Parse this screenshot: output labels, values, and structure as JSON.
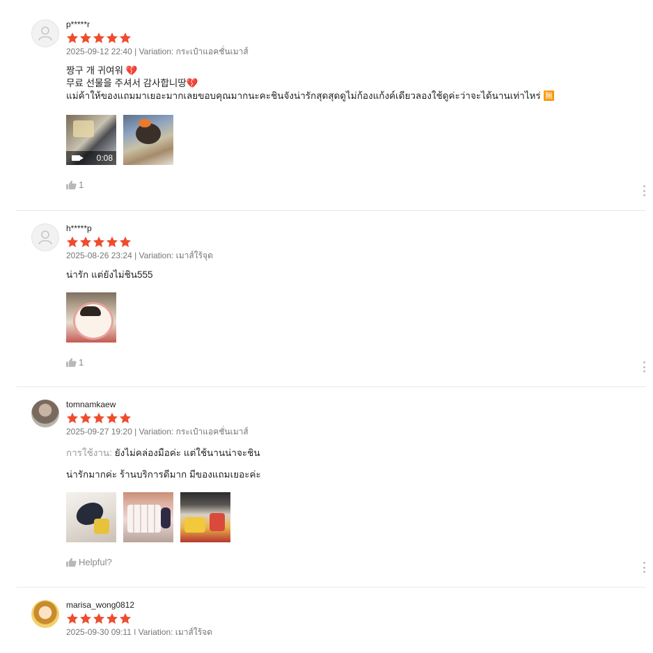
{
  "reviews": [
    {
      "username": "p*****r",
      "rating": 5,
      "meta": "2025-09-12 22:40 | Variation: กระเป๋าแอคชั่นเมาส์",
      "text_lines": [
        "짱구 개 귀여워 💔",
        "무료 선물을 주셔서 감사합니땅💔",
        "แม่ค้าให้ของแถมมาเยอะมากเลยขอบคุณมากนะคะชินจังน่ารักสุดสุดดูไม่ก้องแก้งค์เดียวลองใช้ดูค่ะว่าจะได้นานเท่าไหร่ 🈚"
      ],
      "media": [
        {
          "type": "video",
          "duration": "0:08",
          "icon": "video-camera-icon"
        },
        {
          "type": "photo"
        }
      ],
      "likes": "1"
    },
    {
      "username": "h*****p",
      "rating": 5,
      "meta": "2025-08-26 23:24 | Variation: เมาส์ใร้จุด",
      "text_lines": [
        "น่ารัก แต่ยังไม่ชิน555"
      ],
      "media": [
        {
          "type": "photo"
        }
      ],
      "likes": "1"
    },
    {
      "username": "tomnamkaew",
      "rating": 5,
      "meta": "2025-09-27 19:20 | Variation: กระเป๋าแอคชั่นเมาส์",
      "attribute_label": "การใช้งาน:",
      "attribute_value": "ยังไม่คล่องมือค่ะ แต่ใช้นานน่าจะชิน",
      "text_lines": [
        "น่ารักมากค่ะ ร้านบริการดีมาก มีของแถมเยอะค่ะ"
      ],
      "media": [
        {
          "type": "photo"
        },
        {
          "type": "photo"
        },
        {
          "type": "photo"
        }
      ],
      "likes": "Helpful?"
    },
    {
      "username": "marisa_wong0812",
      "rating": 5,
      "meta": "2025-09-30 09:11 | Variation: เมาส์ใร้จุด"
    }
  ],
  "colors": {
    "star": "#ee4d2d",
    "meta_text": "#757575",
    "divider": "#e8e8e8",
    "like_text": "#8a8a8a"
  },
  "icons": {
    "star": "star-icon",
    "like": "thumbs-up-icon",
    "more": "more-vertical-icon",
    "avatar_default": "user-avatar-icon"
  }
}
